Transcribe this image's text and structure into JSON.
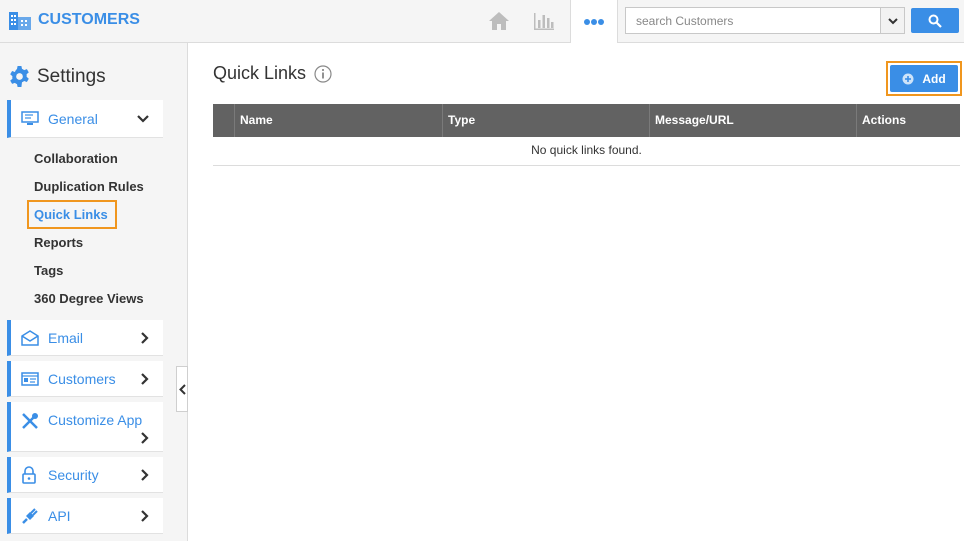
{
  "app": {
    "title": "CUSTOMERS"
  },
  "topnav": {
    "items": [
      {
        "icon": "home-icon"
      },
      {
        "icon": "bar-chart-icon"
      },
      {
        "icon": "more-dots-icon"
      }
    ],
    "search": {
      "placeholder": "search Customers",
      "value": ""
    }
  },
  "sidebar": {
    "title": "Settings",
    "general": {
      "label": "General",
      "sub_items": [
        {
          "label": "Collaboration"
        },
        {
          "label": "Duplication Rules"
        },
        {
          "label": "Quick Links",
          "active": true
        },
        {
          "label": "Reports"
        },
        {
          "label": "Tags"
        },
        {
          "label": "360 Degree Views"
        }
      ]
    },
    "sections": [
      {
        "label": "Email",
        "icon": "email-icon"
      },
      {
        "label": "Customers",
        "icon": "customers-icon"
      },
      {
        "label": "Customize App",
        "icon": "tools-icon"
      },
      {
        "label": "Security",
        "icon": "lock-icon"
      },
      {
        "label": "API",
        "icon": "plug-icon"
      }
    ]
  },
  "main": {
    "title": "Quick Links",
    "add_label": "Add",
    "table": {
      "columns": [
        "Name",
        "Type",
        "Message/URL",
        "Actions"
      ],
      "empty_message": "No quick links found."
    }
  },
  "colors": {
    "accent": "#3a8ee6",
    "highlight": "#f0961e",
    "header": "#626262"
  }
}
